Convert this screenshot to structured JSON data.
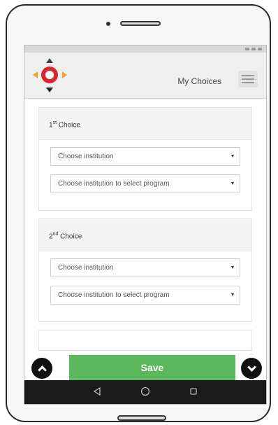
{
  "header": {
    "title": "My Choices",
    "logo_icon": "compass-logo-icon",
    "menu_icon": "hamburger-menu-icon"
  },
  "choices": [
    {
      "ordinal": "1",
      "suffix": "st",
      "label": "Choice",
      "institution_placeholder": "Choose institution",
      "program_placeholder": "Choose institution to select program"
    },
    {
      "ordinal": "2",
      "suffix": "nd",
      "label": "Choice",
      "institution_placeholder": "Choose institution",
      "program_placeholder": "Choose institution to select program"
    }
  ],
  "footer": {
    "save_label": "Save",
    "save_color": "#5cb85c",
    "scroll_up_icon": "chevron-up-icon",
    "scroll_down_icon": "chevron-down-icon"
  },
  "navbar": {
    "back_icon": "back-triangle-icon",
    "home_icon": "home-circle-icon",
    "recent_icon": "recent-apps-square-icon"
  }
}
